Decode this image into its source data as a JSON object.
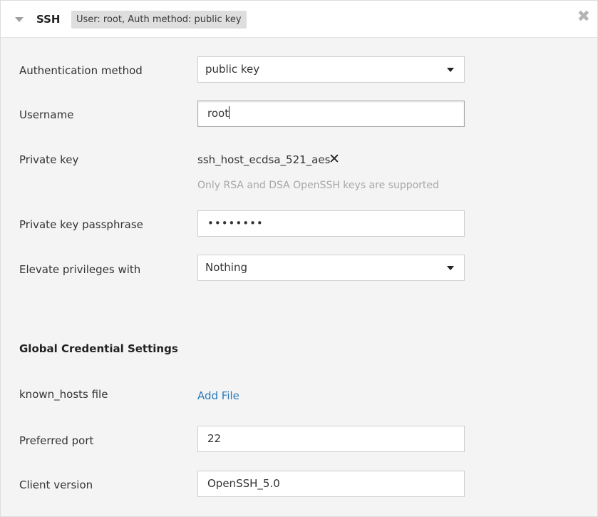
{
  "header": {
    "title": "SSH",
    "summary_badge": "User: root, Auth method: public key",
    "close_glyph": "✖"
  },
  "form": {
    "auth_method": {
      "label": "Authentication method",
      "value": "public key"
    },
    "username": {
      "label": "Username",
      "value": "root"
    },
    "private_key": {
      "label": "Private key",
      "filename": "ssh_host_ecdsa_521_aes",
      "remove_glyph": "✕",
      "help": "Only RSA and DSA OpenSSH keys are supported"
    },
    "passphrase": {
      "label": "Private key passphrase",
      "masked_value": "••••••••"
    },
    "elevate": {
      "label": "Elevate privileges with",
      "value": "Nothing"
    }
  },
  "global": {
    "heading": "Global Credential Settings",
    "known_hosts": {
      "label": "known_hosts file",
      "link": "Add File"
    },
    "preferred_port": {
      "label": "Preferred port",
      "value": "22"
    },
    "client_version": {
      "label": "Client version",
      "value": "OpenSSH_5.0"
    }
  },
  "colors": {
    "link": "#2b7ab8",
    "panel_bg": "#f4f4f4",
    "header_bg": "#ffffff",
    "badge_bg": "#dedede",
    "help_text": "#a7a7a7"
  },
  "icons": [
    "collapse-caret-icon",
    "close-icon",
    "dropdown-arrow-icon",
    "remove-key-icon"
  ]
}
